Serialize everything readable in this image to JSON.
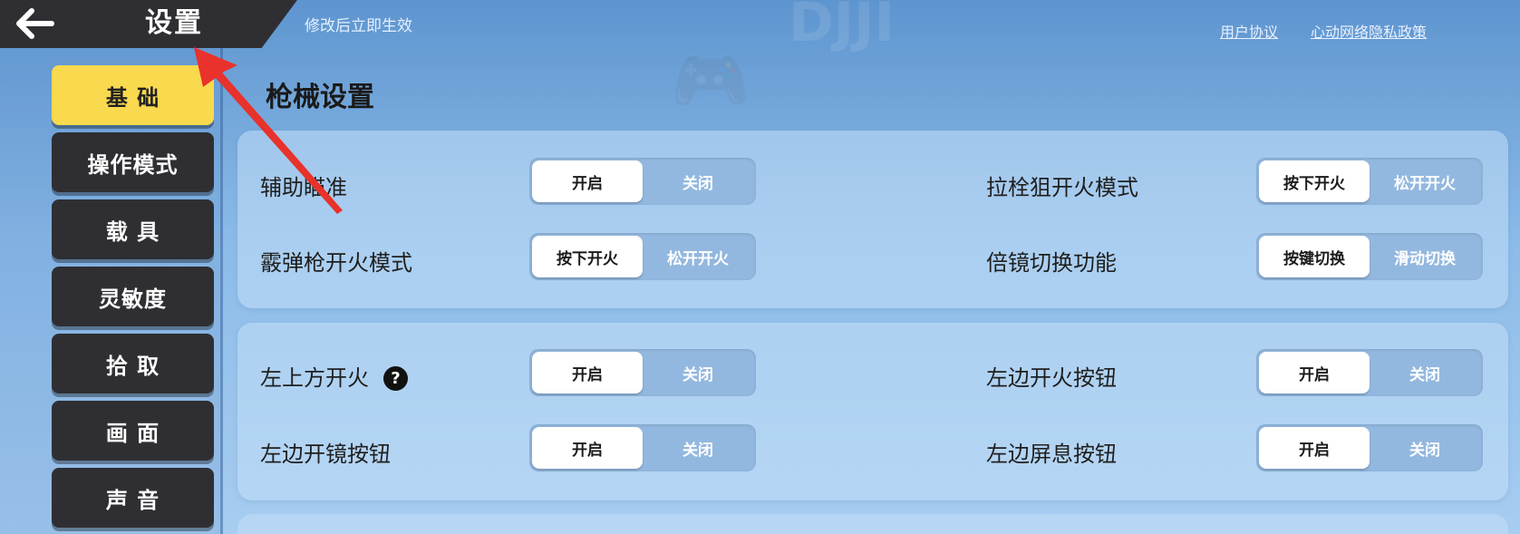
{
  "header": {
    "title": "设置",
    "hint": "修改后立即生效",
    "links": {
      "user_agreement": "用户协议",
      "privacy_policy": "心动网络隐私政策"
    }
  },
  "sidebar": {
    "items": [
      {
        "label": "基 础",
        "active": true
      },
      {
        "label": "操作模式",
        "active": false
      },
      {
        "label": "载 具",
        "active": false
      },
      {
        "label": "灵敏度",
        "active": false
      },
      {
        "label": "拾 取",
        "active": false
      },
      {
        "label": "画 面",
        "active": false
      },
      {
        "label": "声 音",
        "active": false
      }
    ]
  },
  "main": {
    "section_title": "枪械设置",
    "group1": {
      "aim_assist": {
        "label": "辅助瞄准",
        "on": "开启",
        "off": "关闭",
        "selected": "开启"
      },
      "bolt_sniper_fire": {
        "label": "拉栓狙开火模式",
        "on": "按下开火",
        "off": "松开开火",
        "selected": "按下开火"
      },
      "shotgun_fire": {
        "label": "霰弹枪开火模式",
        "on": "按下开火",
        "off": "松开开火",
        "selected": "按下开火"
      },
      "scope_switch": {
        "label": "倍镜切换功能",
        "on": "按键切换",
        "off": "滑动切换",
        "selected": "按键切换"
      }
    },
    "group2": {
      "top_left_fire": {
        "label": "左上方开火",
        "help": "?",
        "on": "开启",
        "off": "关闭",
        "selected": "开启"
      },
      "left_fire_button": {
        "label": "左边开火按钮",
        "on": "开启",
        "off": "关闭",
        "selected": "开启"
      },
      "left_scope_button": {
        "label": "左边开镜按钮",
        "on": "开启",
        "off": "关闭",
        "selected": "开启"
      },
      "left_hold_breath_button": {
        "label": "左边屏息按钮",
        "on": "开启",
        "off": "关闭",
        "selected": "开启"
      }
    }
  },
  "colors": {
    "accent_yellow": "#f9d94e",
    "dark_button": "#2f2f33",
    "annotation_arrow": "#e8322b"
  }
}
